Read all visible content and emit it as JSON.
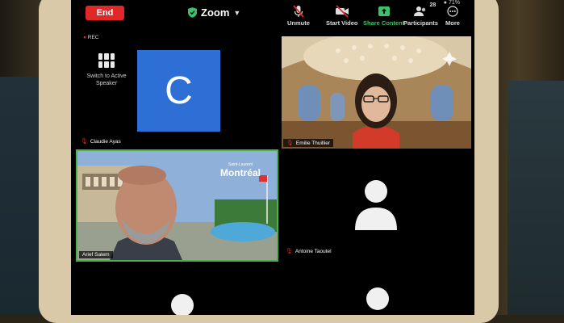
{
  "meeting": {
    "app_title": "Zoom",
    "recording_label": "REC"
  },
  "toolbar": {
    "end_label": "End",
    "unmute_label": "Unmute",
    "start_video_label": "Start Video",
    "share_content_label": "Share Content",
    "participants_label": "Participants",
    "participants_count": "28",
    "more_label": "More",
    "battery": "71%"
  },
  "switch_speaker_label": "Switch to Active Speaker",
  "tiles": {
    "claudie": {
      "name": "Claudie Ayas",
      "initial": "C"
    },
    "emilie": {
      "name": "Emilie Thuillier"
    },
    "arief": {
      "name": "Arief Salem",
      "overlay_small": "Saint-Laurent",
      "overlay_big": "Montréal"
    },
    "antoine": {
      "name": "Antoine Taoutel"
    }
  },
  "colors": {
    "end_red": "#e02828",
    "share_green": "#3cc06a",
    "active_border": "#4caf50",
    "avatar_blue": "#2e6fd6"
  }
}
